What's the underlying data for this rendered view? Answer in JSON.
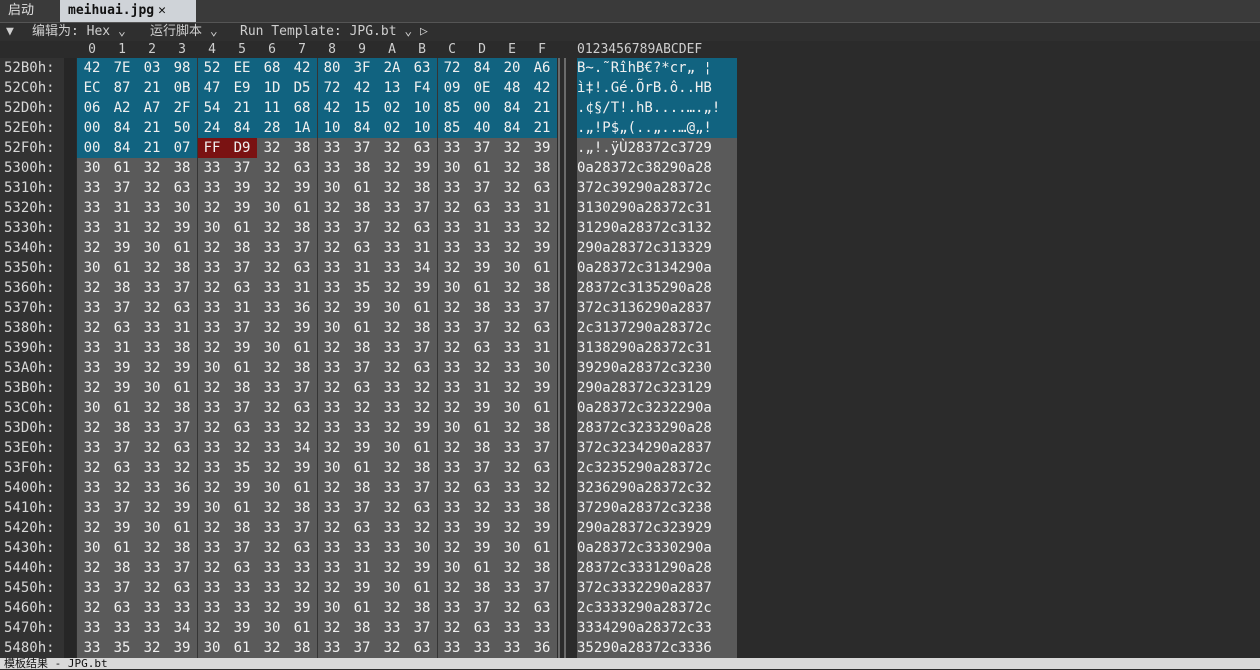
{
  "tabs": [
    {
      "label": "启动"
    },
    {
      "label": "meihuai.jpg"
    }
  ],
  "toolbar": {
    "edit_as_label": "编辑为: Hex",
    "run_script_label": "运行脚本",
    "run_template_label": "Run Template: JPG.bt"
  },
  "columns": [
    "0",
    "1",
    "2",
    "3",
    "4",
    "5",
    "6",
    "7",
    "8",
    "9",
    "A",
    "B",
    "C",
    "D",
    "E",
    "F"
  ],
  "ascii_header": "0123456789ABCDEF",
  "colors": {
    "selected": "#116380",
    "highlight_marker": "#7a1212",
    "normal_bytes": "#5a5a5a"
  },
  "rows": [
    {
      "offset": "52B0h:",
      "bytes": [
        "42",
        "7E",
        "03",
        "98",
        "52",
        "EE",
        "68",
        "42",
        "80",
        "3F",
        "2A",
        "63",
        "72",
        "84",
        "20",
        "A6"
      ],
      "ascii": "B~.˜RîhB€?*cr„ ¦"
    },
    {
      "offset": "52C0h:",
      "bytes": [
        "EC",
        "87",
        "21",
        "0B",
        "47",
        "E9",
        "1D",
        "D5",
        "72",
        "42",
        "13",
        "F4",
        "09",
        "0E",
        "48",
        "42"
      ],
      "ascii": "ì‡!.Gé.ÕrB.ô..HB"
    },
    {
      "offset": "52D0h:",
      "bytes": [
        "06",
        "A2",
        "A7",
        "2F",
        "54",
        "21",
        "11",
        "68",
        "42",
        "15",
        "02",
        "10",
        "85",
        "00",
        "84",
        "21"
      ],
      "ascii": ".¢§/T!.hB....….„!"
    },
    {
      "offset": "52E0h:",
      "bytes": [
        "00",
        "84",
        "21",
        "50",
        "24",
        "84",
        "28",
        "1A",
        "10",
        "84",
        "02",
        "10",
        "85",
        "40",
        "84",
        "21"
      ],
      "ascii": ".„!P$„(..„..…@„!"
    },
    {
      "offset": "52F0h:",
      "bytes": [
        "00",
        "84",
        "21",
        "07",
        "FF",
        "D9",
        "32",
        "38",
        "33",
        "37",
        "32",
        "63",
        "33",
        "37",
        "32",
        "39"
      ],
      "ascii": ".„!.ÿÙ28372c3729"
    },
    {
      "offset": "5300h:",
      "bytes": [
        "30",
        "61",
        "32",
        "38",
        "33",
        "37",
        "32",
        "63",
        "33",
        "38",
        "32",
        "39",
        "30",
        "61",
        "32",
        "38"
      ],
      "ascii": "0a28372c38290a28"
    },
    {
      "offset": "5310h:",
      "bytes": [
        "33",
        "37",
        "32",
        "63",
        "33",
        "39",
        "32",
        "39",
        "30",
        "61",
        "32",
        "38",
        "33",
        "37",
        "32",
        "63"
      ],
      "ascii": "372c39290a28372c"
    },
    {
      "offset": "5320h:",
      "bytes": [
        "33",
        "31",
        "33",
        "30",
        "32",
        "39",
        "30",
        "61",
        "32",
        "38",
        "33",
        "37",
        "32",
        "63",
        "33",
        "31"
      ],
      "ascii": "3130290a28372c31"
    },
    {
      "offset": "5330h:",
      "bytes": [
        "33",
        "31",
        "32",
        "39",
        "30",
        "61",
        "32",
        "38",
        "33",
        "37",
        "32",
        "63",
        "33",
        "31",
        "33",
        "32"
      ],
      "ascii": "31290a28372c3132"
    },
    {
      "offset": "5340h:",
      "bytes": [
        "32",
        "39",
        "30",
        "61",
        "32",
        "38",
        "33",
        "37",
        "32",
        "63",
        "33",
        "31",
        "33",
        "33",
        "32",
        "39"
      ],
      "ascii": "290a28372c313329"
    },
    {
      "offset": "5350h:",
      "bytes": [
        "30",
        "61",
        "32",
        "38",
        "33",
        "37",
        "32",
        "63",
        "33",
        "31",
        "33",
        "34",
        "32",
        "39",
        "30",
        "61"
      ],
      "ascii": "0a28372c3134290a"
    },
    {
      "offset": "5360h:",
      "bytes": [
        "32",
        "38",
        "33",
        "37",
        "32",
        "63",
        "33",
        "31",
        "33",
        "35",
        "32",
        "39",
        "30",
        "61",
        "32",
        "38"
      ],
      "ascii": "28372c3135290a28"
    },
    {
      "offset": "5370h:",
      "bytes": [
        "33",
        "37",
        "32",
        "63",
        "33",
        "31",
        "33",
        "36",
        "32",
        "39",
        "30",
        "61",
        "32",
        "38",
        "33",
        "37"
      ],
      "ascii": "372c3136290a2837"
    },
    {
      "offset": "5380h:",
      "bytes": [
        "32",
        "63",
        "33",
        "31",
        "33",
        "37",
        "32",
        "39",
        "30",
        "61",
        "32",
        "38",
        "33",
        "37",
        "32",
        "63"
      ],
      "ascii": "2c3137290a28372c"
    },
    {
      "offset": "5390h:",
      "bytes": [
        "33",
        "31",
        "33",
        "38",
        "32",
        "39",
        "30",
        "61",
        "32",
        "38",
        "33",
        "37",
        "32",
        "63",
        "33",
        "31"
      ],
      "ascii": "3138290a28372c31"
    },
    {
      "offset": "53A0h:",
      "bytes": [
        "33",
        "39",
        "32",
        "39",
        "30",
        "61",
        "32",
        "38",
        "33",
        "37",
        "32",
        "63",
        "33",
        "32",
        "33",
        "30"
      ],
      "ascii": "39290a28372c3230"
    },
    {
      "offset": "53B0h:",
      "bytes": [
        "32",
        "39",
        "30",
        "61",
        "32",
        "38",
        "33",
        "37",
        "32",
        "63",
        "33",
        "32",
        "33",
        "31",
        "32",
        "39"
      ],
      "ascii": "290a28372c323129"
    },
    {
      "offset": "53C0h:",
      "bytes": [
        "30",
        "61",
        "32",
        "38",
        "33",
        "37",
        "32",
        "63",
        "33",
        "32",
        "33",
        "32",
        "32",
        "39",
        "30",
        "61"
      ],
      "ascii": "0a28372c3232290a"
    },
    {
      "offset": "53D0h:",
      "bytes": [
        "32",
        "38",
        "33",
        "37",
        "32",
        "63",
        "33",
        "32",
        "33",
        "33",
        "32",
        "39",
        "30",
        "61",
        "32",
        "38"
      ],
      "ascii": "28372c3233290a28"
    },
    {
      "offset": "53E0h:",
      "bytes": [
        "33",
        "37",
        "32",
        "63",
        "33",
        "32",
        "33",
        "34",
        "32",
        "39",
        "30",
        "61",
        "32",
        "38",
        "33",
        "37"
      ],
      "ascii": "372c3234290a2837"
    },
    {
      "offset": "53F0h:",
      "bytes": [
        "32",
        "63",
        "33",
        "32",
        "33",
        "35",
        "32",
        "39",
        "30",
        "61",
        "32",
        "38",
        "33",
        "37",
        "32",
        "63"
      ],
      "ascii": "2c3235290a28372c"
    },
    {
      "offset": "5400h:",
      "bytes": [
        "33",
        "32",
        "33",
        "36",
        "32",
        "39",
        "30",
        "61",
        "32",
        "38",
        "33",
        "37",
        "32",
        "63",
        "33",
        "32"
      ],
      "ascii": "3236290a28372c32"
    },
    {
      "offset": "5410h:",
      "bytes": [
        "33",
        "37",
        "32",
        "39",
        "30",
        "61",
        "32",
        "38",
        "33",
        "37",
        "32",
        "63",
        "33",
        "32",
        "33",
        "38"
      ],
      "ascii": "37290a28372c3238"
    },
    {
      "offset": "5420h:",
      "bytes": [
        "32",
        "39",
        "30",
        "61",
        "32",
        "38",
        "33",
        "37",
        "32",
        "63",
        "33",
        "32",
        "33",
        "39",
        "32",
        "39"
      ],
      "ascii": "290a28372c323929"
    },
    {
      "offset": "5430h:",
      "bytes": [
        "30",
        "61",
        "32",
        "38",
        "33",
        "37",
        "32",
        "63",
        "33",
        "33",
        "33",
        "30",
        "32",
        "39",
        "30",
        "61"
      ],
      "ascii": "0a28372c3330290a"
    },
    {
      "offset": "5440h:",
      "bytes": [
        "32",
        "38",
        "33",
        "37",
        "32",
        "63",
        "33",
        "33",
        "33",
        "31",
        "32",
        "39",
        "30",
        "61",
        "32",
        "38"
      ],
      "ascii": "28372c3331290a28"
    },
    {
      "offset": "5450h:",
      "bytes": [
        "33",
        "37",
        "32",
        "63",
        "33",
        "33",
        "33",
        "32",
        "32",
        "39",
        "30",
        "61",
        "32",
        "38",
        "33",
        "37"
      ],
      "ascii": "372c3332290a2837"
    },
    {
      "offset": "5460h:",
      "bytes": [
        "32",
        "63",
        "33",
        "33",
        "33",
        "33",
        "32",
        "39",
        "30",
        "61",
        "32",
        "38",
        "33",
        "37",
        "32",
        "63"
      ],
      "ascii": "2c3333290a28372c"
    },
    {
      "offset": "5470h:",
      "bytes": [
        "33",
        "33",
        "33",
        "34",
        "32",
        "39",
        "30",
        "61",
        "32",
        "38",
        "33",
        "37",
        "32",
        "63",
        "33",
        "33"
      ],
      "ascii": "3334290a28372c33"
    },
    {
      "offset": "5480h:",
      "bytes": [
        "33",
        "35",
        "32",
        "39",
        "30",
        "61",
        "32",
        "38",
        "33",
        "37",
        "32",
        "63",
        "33",
        "33",
        "33",
        "36"
      ],
      "ascii": "35290a28372c3336"
    }
  ],
  "status": "模板结果 - JPG.bt"
}
